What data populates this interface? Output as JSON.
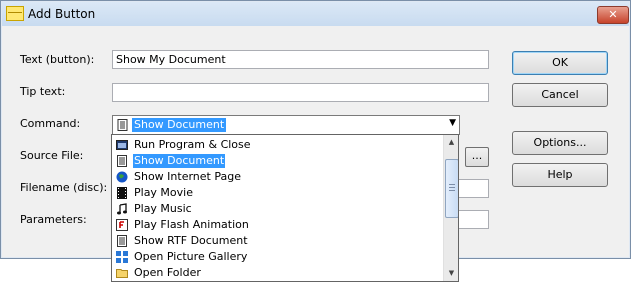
{
  "window": {
    "title": "Add Button",
    "close_glyph": "✕"
  },
  "fields": {
    "text_label": "Text (button):",
    "text_value": "Show My Document",
    "tip_label": "Tip text:",
    "tip_value": "",
    "command_label": "Command:",
    "command_value": "Show Document",
    "source_label": "Source File:",
    "filename_label": "Filename (disc):",
    "parameters_label": "Parameters:"
  },
  "buttons": {
    "ok": "OK",
    "cancel": "Cancel",
    "options": "Options...",
    "help": "Help",
    "browse": "..."
  },
  "dropdown": {
    "items": [
      {
        "label": "Run Program & Close",
        "icon": "program-icon"
      },
      {
        "label": "Show Document",
        "icon": "document-icon",
        "selected": true
      },
      {
        "label": "Show Internet Page",
        "icon": "globe-icon"
      },
      {
        "label": "Play Movie",
        "icon": "film-icon"
      },
      {
        "label": "Play Music",
        "icon": "music-note-icon"
      },
      {
        "label": "Play Flash Animation",
        "icon": "flash-icon"
      },
      {
        "label": "Show RTF Document",
        "icon": "rtf-document-icon"
      },
      {
        "label": "Open Picture Gallery",
        "icon": "gallery-icon"
      },
      {
        "label": "Open Folder",
        "icon": "folder-icon"
      }
    ]
  },
  "colors": {
    "selection": "#3399ff",
    "title_bar": "#c8dbf0",
    "close": "#c7432b"
  }
}
